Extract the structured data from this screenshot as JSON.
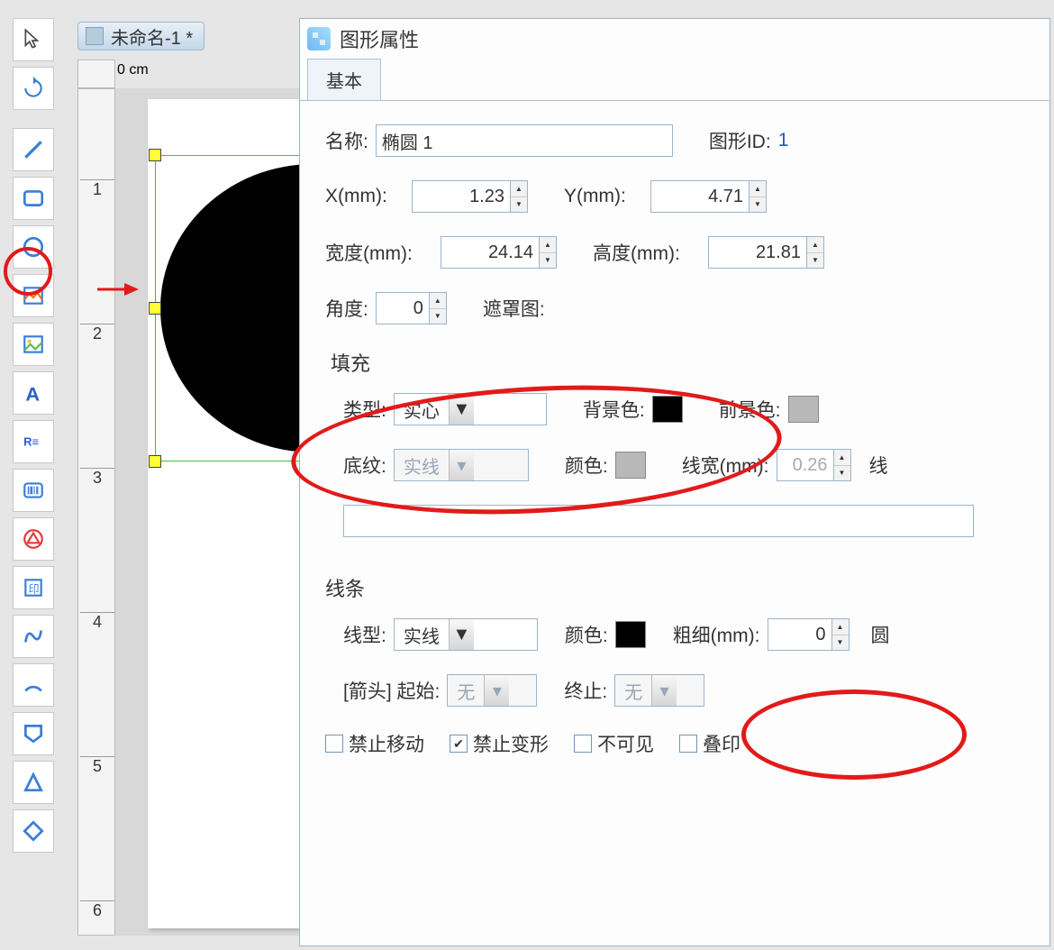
{
  "document": {
    "tab_title": "未命名-1 *",
    "ruler_unit": "0 cm"
  },
  "ruler": {
    "ticks": [
      "1",
      "2",
      "3",
      "4",
      "5",
      "6"
    ]
  },
  "tools": [
    {
      "name": "select-tool"
    },
    {
      "name": "rotate-tool"
    },
    {
      "sep": true
    },
    {
      "name": "line-tool"
    },
    {
      "name": "rect-tool"
    },
    {
      "name": "ellipse-tool"
    },
    {
      "name": "image-tool"
    },
    {
      "name": "picture-tool"
    },
    {
      "name": "text-tool"
    },
    {
      "name": "richtext-tool"
    },
    {
      "name": "barcode-tool"
    },
    {
      "name": "triangle-tool"
    },
    {
      "name": "stamp-tool"
    },
    {
      "name": "curve-tool"
    },
    {
      "name": "arc-tool"
    },
    {
      "name": "polygon-tool"
    },
    {
      "name": "triangle2-tool"
    },
    {
      "name": "diamond-tool"
    }
  ],
  "props": {
    "title": "图形属性",
    "tab_basic": "基本",
    "labels": {
      "name": "名称:",
      "shape_id": "图形ID:",
      "x": "X(mm):",
      "y": "Y(mm):",
      "width": "宽度(mm):",
      "height": "高度(mm):",
      "angle": "角度:",
      "mask": "遮罩图:",
      "fill_section": "填充",
      "type": "类型:",
      "bg_color": "背景色:",
      "fg_color": "前景色:",
      "pattern": "底纹:",
      "color": "颜色:",
      "line_width": "线宽(mm):",
      "line_section": "线条",
      "line_type": "线型:",
      "thickness": "粗细(mm):",
      "arrow": "[箭头] 起始:",
      "end": "终止:",
      "round_suffix": "圆",
      "line_suffix": "线"
    },
    "values": {
      "name": "椭圆 1",
      "shape_id": "1",
      "x": "1.23",
      "y": "4.71",
      "width": "24.14",
      "height": "21.81",
      "angle": "0",
      "mask": "",
      "fill_type": "实心",
      "pattern": "实线",
      "line_width": "0.26",
      "line_type": "实线",
      "thickness": "0",
      "arrow_start": "无",
      "arrow_end": "无"
    },
    "checkboxes": {
      "lock_move": "禁止移动",
      "lock_transform": "禁止变形",
      "invisible": "不可见",
      "overprint": "叠印",
      "lock_transform_checked": true
    }
  }
}
